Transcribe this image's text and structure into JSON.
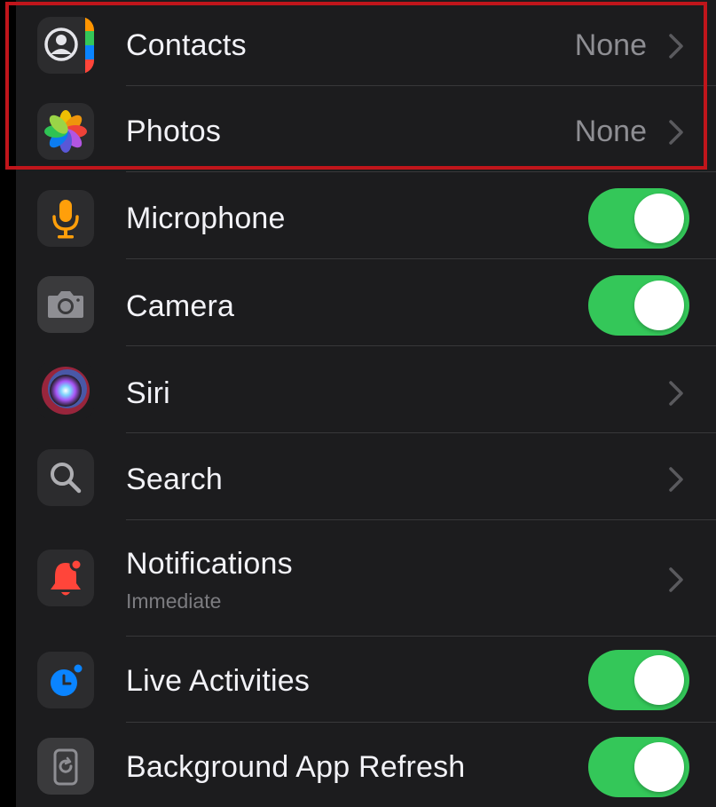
{
  "colors": {
    "background": "#1c1c1e",
    "toggle_on": "#34c759",
    "highlight_border": "#c0151b",
    "label": "#f2f2f7",
    "secondary": "#8e8e93"
  },
  "rows": [
    {
      "label": "Contacts",
      "value": "None",
      "icon": "contacts-icon",
      "accessory": "chevron"
    },
    {
      "label": "Photos",
      "value": "None",
      "icon": "photos-icon",
      "accessory": "chevron"
    },
    {
      "label": "Microphone",
      "icon": "microphone-icon",
      "accessory": "toggle",
      "toggle_on": true
    },
    {
      "label": "Camera",
      "icon": "camera-icon",
      "accessory": "toggle",
      "toggle_on": true
    },
    {
      "label": "Siri",
      "icon": "siri-icon",
      "accessory": "chevron"
    },
    {
      "label": "Search",
      "icon": "search-icon",
      "accessory": "chevron"
    },
    {
      "label": "Notifications",
      "sublabel": "Immediate",
      "icon": "notifications-icon",
      "accessory": "chevron"
    },
    {
      "label": "Live Activities",
      "icon": "live-activities-icon",
      "accessory": "toggle",
      "toggle_on": true
    },
    {
      "label": "Background App Refresh",
      "icon": "background-app-refresh-icon",
      "accessory": "toggle",
      "toggle_on": true
    }
  ]
}
